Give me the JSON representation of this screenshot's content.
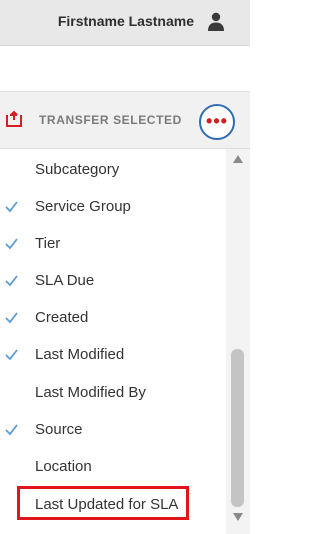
{
  "header": {
    "user_name": "Firstname Lastname",
    "user_icon": "person-icon"
  },
  "toolbar": {
    "transfer_icon": "transfer-icon",
    "transfer_label": "TRANSFER SELECTED",
    "more_button_icon": "more-icon",
    "more_dots": "•••"
  },
  "menu": {
    "items": [
      {
        "label": "Subcategory",
        "checked": false
      },
      {
        "label": "Service Group",
        "checked": true
      },
      {
        "label": "Tier",
        "checked": true
      },
      {
        "label": "SLA Due",
        "checked": true
      },
      {
        "label": "Created",
        "checked": true
      },
      {
        "label": "Last Modified",
        "checked": true
      },
      {
        "label": "Last Modified By",
        "checked": false
      },
      {
        "label": "Source",
        "checked": true
      },
      {
        "label": "Location",
        "checked": false
      },
      {
        "label": "Last Updated for SLA",
        "checked": false,
        "highlighted": true
      }
    ]
  },
  "colors": {
    "accent_blue": "#2f6db3",
    "check_blue": "#5b9bd5",
    "alert_red": "#e2151a"
  }
}
